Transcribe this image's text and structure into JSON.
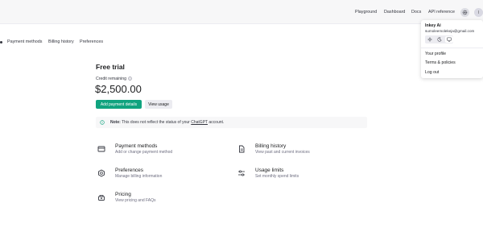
{
  "topnav": {
    "items": [
      {
        "label": "Playground"
      },
      {
        "label": "Dashboard"
      },
      {
        "label": "Docs"
      },
      {
        "label": "API reference"
      }
    ],
    "settings_icon": "gear-icon",
    "avatar_initial": "I"
  },
  "subnav": {
    "items": [
      {
        "label": "Payment methods"
      },
      {
        "label": "Billing history"
      },
      {
        "label": "Preferences"
      }
    ]
  },
  "main": {
    "title": "Free trial",
    "credit_label": "Credit remaining",
    "credit_amount": "$2,500.00",
    "add_payment_label": "Add payment details",
    "view_usage_label": "View usage",
    "note_bold": "Note:",
    "note_text_before": " This does not reflect the status of your ",
    "note_link": "ChatGPT",
    "note_text_after": " account."
  },
  "cards": [
    {
      "title": "Payment methods",
      "subtitle": "Add or change payment method",
      "icon": "credit-card-icon"
    },
    {
      "title": "Billing history",
      "subtitle": "View past and current invoices",
      "icon": "document-icon"
    },
    {
      "title": "Preferences",
      "subtitle": "Manage billing information",
      "icon": "settings-icon"
    },
    {
      "title": "Usage limits",
      "subtitle": "Set monthly spend limits",
      "icon": "sliders-icon"
    },
    {
      "title": "Pricing",
      "subtitle": "View pricing and FAQs",
      "icon": "pricing-icon"
    }
  ],
  "user_menu": {
    "name": "Inkey Ai",
    "email": "sumoleemolekeja@gmail.com",
    "theme_options": [
      "sun-icon",
      "moon-icon",
      "monitor-icon"
    ],
    "items": [
      {
        "label": "Your profile"
      },
      {
        "label": "Terms & policies"
      },
      {
        "label": "Log out"
      }
    ]
  },
  "colors": {
    "primary": "#10a37f",
    "topbar_bg": "#f7f7f8",
    "muted_text": "#6e6e80"
  }
}
